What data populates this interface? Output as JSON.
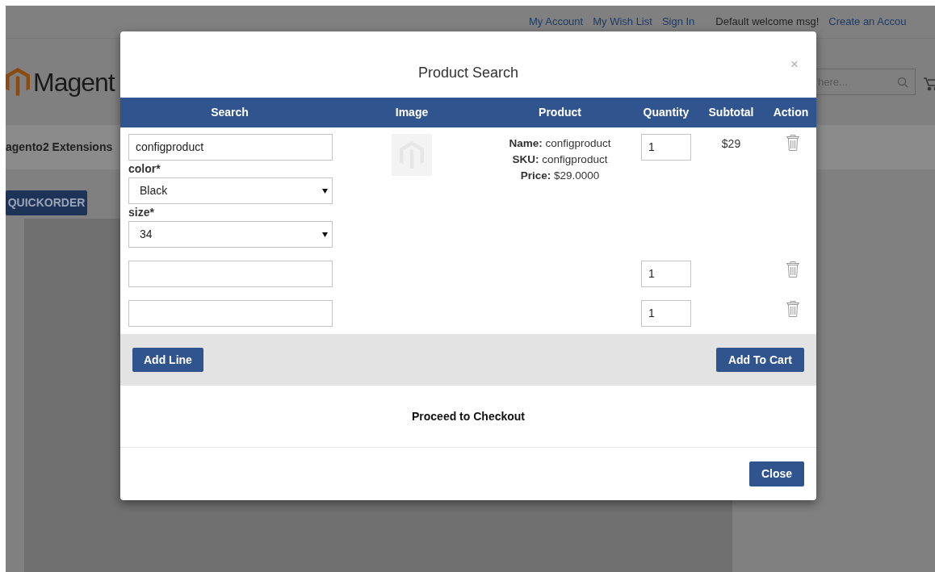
{
  "background_page": {
    "top_links": [
      "My Account",
      "My Wish List",
      "Sign In"
    ],
    "welcome": "Default welcome msg!",
    "create_account": "Create an Accou",
    "logo_text": "Magent",
    "search": {
      "placeholder": "here..."
    },
    "nav_item": "agento2 Extensions",
    "quickorder_button": "QUICKORDER"
  },
  "modal": {
    "title": "Product Search",
    "close_symbol": "×",
    "columns": [
      "Search",
      "Image",
      "Product",
      "Quantity",
      "Subtotal",
      "Action"
    ],
    "rows": [
      {
        "search_value": "configproduct",
        "options": [
          {
            "label": "color*",
            "value": "Black"
          },
          {
            "label": "size*",
            "value": "34"
          }
        ],
        "has_image": true,
        "product": [
          "**Name:** configproduct",
          "**SKU:** configproduct",
          "**Price:** $29.0000"
        ],
        "quantity": "1",
        "subtotal": "$29"
      },
      {
        "has_image": false,
        "quantity": "1"
      },
      {
        "has_image": false,
        "quantity": "1"
      }
    ],
    "add_line_button": "Add Line",
    "add_to_cart_button": "Add To Cart",
    "proceed_link": "Proceed to Checkout",
    "close_button": "Close"
  }
}
